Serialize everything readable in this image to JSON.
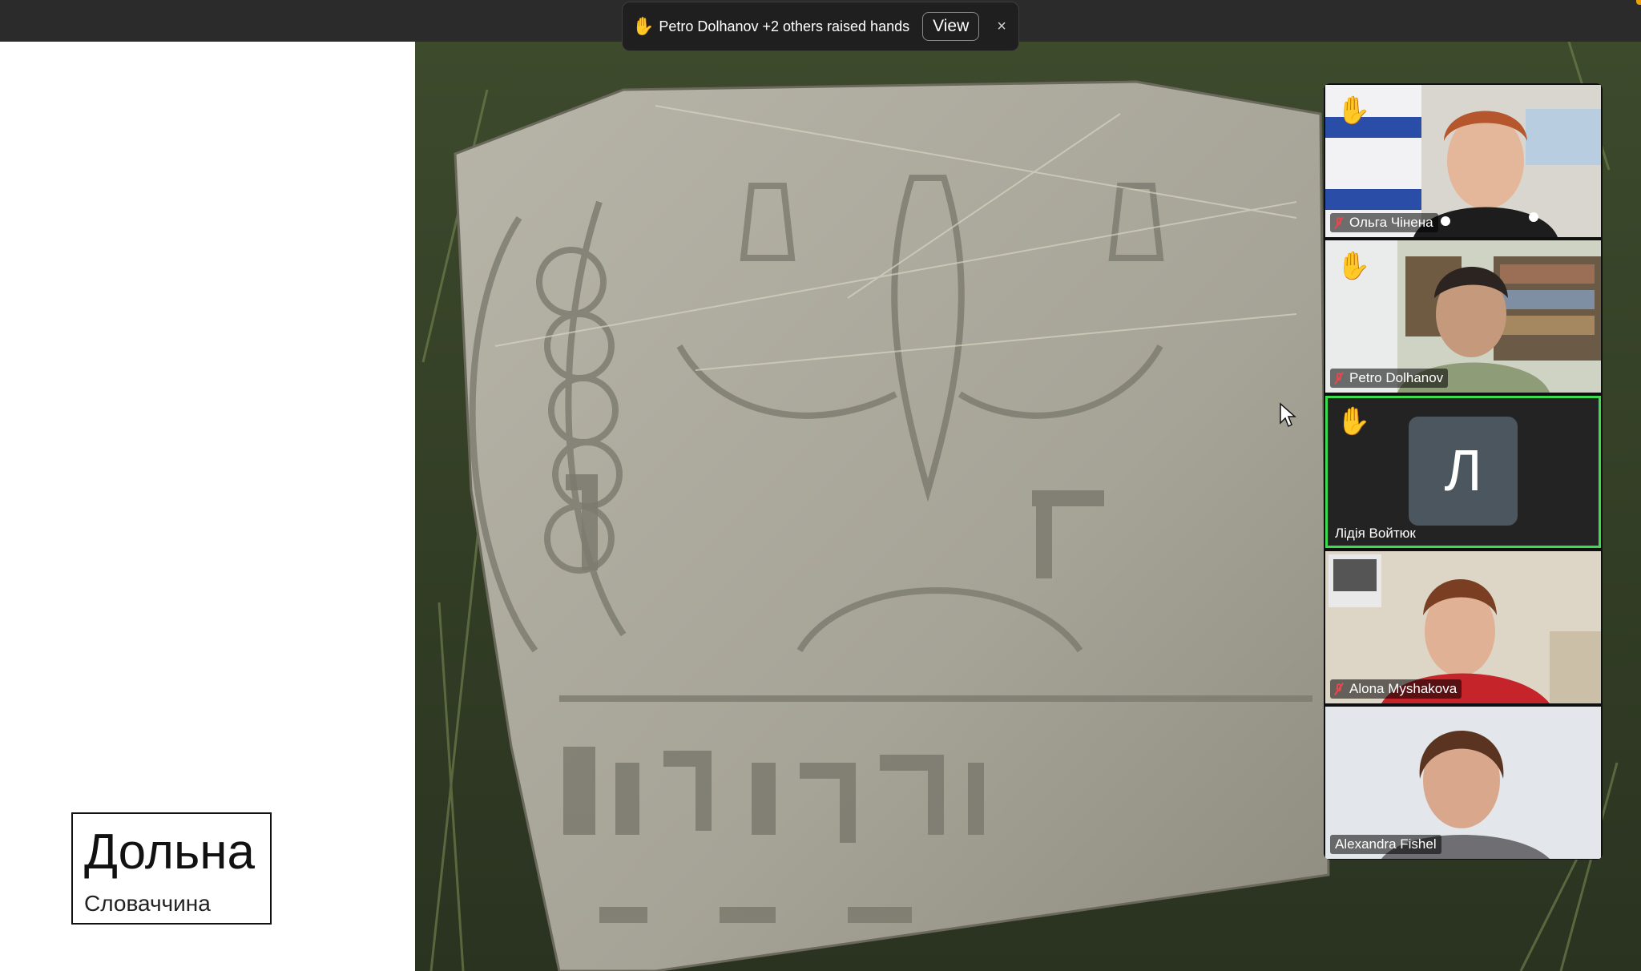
{
  "notification": {
    "hand_icon": "raised-hand-icon",
    "message": "Petro Dolhanov +2 others raised hands",
    "view_label": "View",
    "close_label": "×"
  },
  "slide": {
    "title": "Дольна",
    "subtitle": "Словаччина"
  },
  "gallery": {
    "participants": [
      {
        "name": "Ольга Чінена",
        "muted": true,
        "hand_raised": true
      },
      {
        "name": "Petro Dolhanov",
        "muted": true,
        "hand_raised": true
      },
      {
        "name": "Лідія Войтюк",
        "muted": false,
        "hand_raised": true,
        "avatar_letter": "Л",
        "active_speaker": true
      },
      {
        "name": "Alona Myshakova",
        "muted": true,
        "hand_raised": false
      },
      {
        "name": "Alexandra Fishel",
        "muted": false,
        "hand_raised": false
      }
    ]
  },
  "colors": {
    "toolbar": "#2b2b2b",
    "active_speaker_border": "#3ddc4f",
    "muted_mic": "#e5484d",
    "avatar_bg": "#4c565e"
  }
}
